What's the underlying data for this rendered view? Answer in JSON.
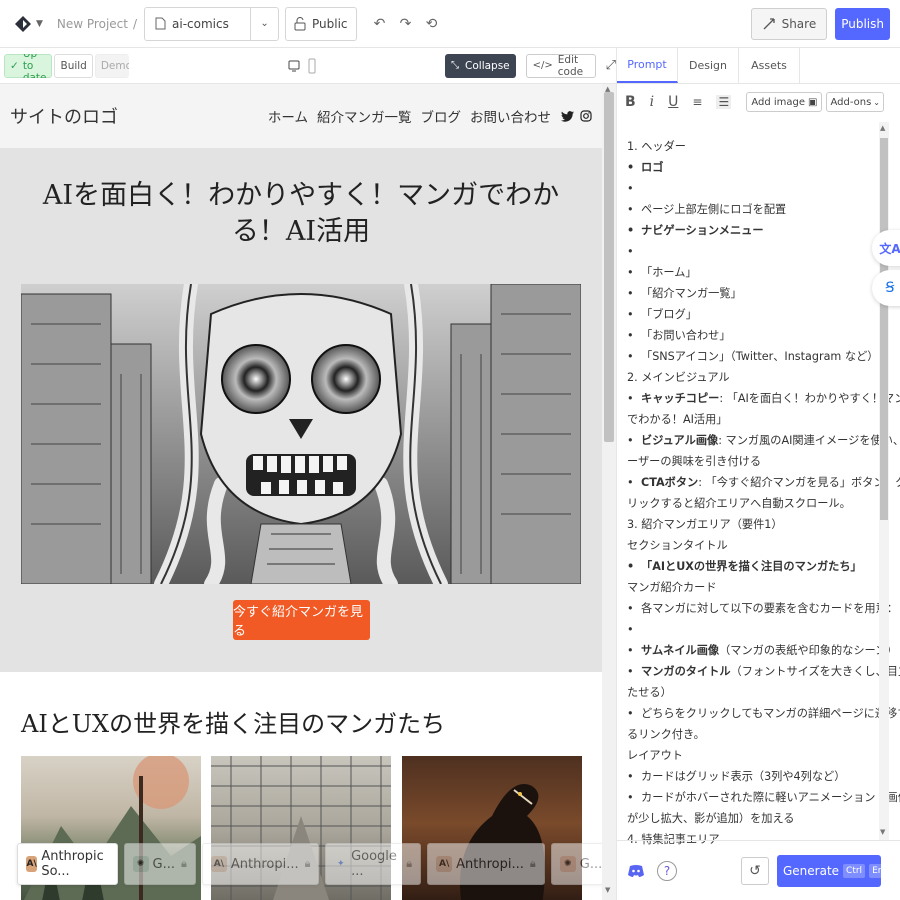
{
  "topbar": {
    "breadcrumb_project": "New Project",
    "breadcrumb_sep": "/",
    "file_name": "ai-comics",
    "visibility_label": "Public",
    "share_label": "Share",
    "publish_label": "Publish"
  },
  "subbar": {
    "status_label": "Up to date",
    "build_label": "Build",
    "demo_label": "Demo",
    "collapse_label": "Collapse",
    "edit_code_label": "Edit code"
  },
  "site": {
    "logo_text": "サイトのロゴ",
    "nav": [
      "ホーム",
      "紹介マンガ一覧",
      "ブログ",
      "お問い合わせ"
    ],
    "hero_title": "AIを面白く！わかりやすく！マンガでわかる！AI活用",
    "cta_label": "今すぐ紹介マンガを見る",
    "section_title": "AIとUXの世界を描く注目のマンガたち"
  },
  "model_chips": [
    {
      "label": "Anthropic So...",
      "locked": false,
      "mark": "A\\",
      "color": "#d9a37a"
    },
    {
      "label": "G...",
      "locked": true,
      "mark": "✺",
      "color": "#cfe3dc"
    },
    {
      "label": "Anthropi...",
      "locked": true,
      "mark": "A\\",
      "color": "#ead2c2"
    },
    {
      "label": "Google ...",
      "locked": true,
      "mark": "✦",
      "color": "#ffffff"
    },
    {
      "label": "Anthropi...",
      "locked": true,
      "mark": "A\\",
      "color": "#ead2c2"
    },
    {
      "label": "G...",
      "locked": true,
      "mark": "✺",
      "color": "#f3d4c8"
    }
  ],
  "panel": {
    "tabs": [
      "Prompt",
      "Design",
      "Assets"
    ],
    "add_image_label": "Add image",
    "addons_label": "Add-ons",
    "generate_label": "Generate",
    "kbd_ctrl": "Ctrl",
    "kbd_enter": "Enter",
    "prompt_lines": [
      {
        "t": "1. ヘッダー",
        "bullet": false,
        "bold": false
      },
      {
        "t": "ロゴ",
        "bullet": true,
        "bold": true
      },
      {
        "t": "",
        "bullet": true,
        "bold": false
      },
      {
        "t": "ページ上部左側にロゴを配置",
        "bullet": true,
        "bold": false
      },
      {
        "t": "ナビゲーションメニュー",
        "bullet": true,
        "bold": true
      },
      {
        "t": "",
        "bullet": true,
        "bold": false
      },
      {
        "t": "「ホーム」",
        "bullet": true,
        "bold": false
      },
      {
        "t": "「紹介マンガ一覧」",
        "bullet": true,
        "bold": false
      },
      {
        "t": "「ブログ」",
        "bullet": true,
        "bold": false
      },
      {
        "t": "「お問い合わせ」",
        "bullet": true,
        "bold": false
      },
      {
        "t": "「SNSアイコン」（Twitter、Instagram など）",
        "bullet": true,
        "bold": false
      },
      {
        "t": "2. メインビジュアル",
        "bullet": false,
        "bold": false
      },
      {
        "t": "キャッチコピー: 「AIを面白く！わかりやすく！マンガ",
        "bullet": true,
        "bold": false,
        "lead": "キャッチコピー"
      },
      {
        "t": "でわかる！AI活用」",
        "bullet": false,
        "bold": false
      },
      {
        "t": "ビジュアル画像: マンガ風のAI関連イメージを使い、ユ",
        "bullet": true,
        "bold": false,
        "lead": "ビジュアル画像"
      },
      {
        "t": "ーザーの興味を引き付ける",
        "bullet": false,
        "bold": false
      },
      {
        "t": "CTAボタン: 「今すぐ紹介マンガを見る」ボタン。ク",
        "bullet": true,
        "bold": false,
        "lead": "CTAボタン"
      },
      {
        "t": "リックすると紹介エリアへ自動スクロール。",
        "bullet": false,
        "bold": false
      },
      {
        "t": "3. 紹介マンガエリア（要件1）",
        "bullet": false,
        "bold": false
      },
      {
        "t": "セクションタイトル",
        "bullet": false,
        "bold": false
      },
      {
        "t": "「AIとUXの世界を描く注目のマンガたち」",
        "bullet": true,
        "bold": true
      },
      {
        "t": "マンガ紹介カード",
        "bullet": false,
        "bold": false
      },
      {
        "t": "各マンガに対して以下の要素を含むカードを用意：",
        "bullet": true,
        "bold": false
      },
      {
        "t": "",
        "bullet": true,
        "bold": false
      },
      {
        "t": "サムネイル画像（マンガの表紙や印象的なシーン）",
        "bullet": true,
        "bold": false,
        "lead": "サムネイル画像"
      },
      {
        "t": "マンガのタイトル（フォントサイズを大きくし、目立",
        "bullet": true,
        "bold": false,
        "lead": "マンガのタイトル"
      },
      {
        "t": "たせる）",
        "bullet": false,
        "bold": false
      },
      {
        "t": "どちらをクリックしてもマンガの詳細ページに遷移す",
        "bullet": true,
        "bold": false
      },
      {
        "t": "るリンク付き。",
        "bullet": false,
        "bold": false
      },
      {
        "t": "レイアウト",
        "bullet": false,
        "bold": false
      },
      {
        "t": "カードはグリッド表示（3列や4列など）",
        "bullet": true,
        "bold": false
      },
      {
        "t": "カードがホバーされた際に軽いアニメーション（画像",
        "bullet": true,
        "bold": false
      },
      {
        "t": "が少し拡大、影が追加）を加える",
        "bullet": false,
        "bold": false
      },
      {
        "t": "4. 特集記事エリア",
        "bullet": false,
        "bold": false
      }
    ]
  },
  "colors": {
    "accent": "#5468ff",
    "cta": "#f15a24",
    "status_green": "#2f9e4e"
  }
}
